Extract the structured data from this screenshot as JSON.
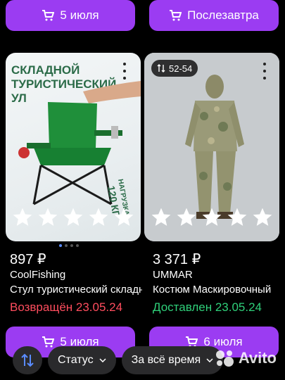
{
  "top_buttons": [
    {
      "label": "5 июля"
    },
    {
      "label": "Послезавтра"
    }
  ],
  "products": [
    {
      "image_caption_top": "СКЛАДНОЙ",
      "image_caption_mid": "ТУРИСТИЧЕСКИЙ",
      "image_caption_bot": "УЛ",
      "image_load_label": "НАГРУЗКА",
      "image_load_value": "120 КГ",
      "price": "897 ₽",
      "brand": "CoolFishing",
      "title": "Стул туристический складной",
      "status": "Возвращён 23.05.24"
    },
    {
      "size_badge": "52-54",
      "price": "3 371 ₽",
      "brand": "UMMAR",
      "title": "Костюм Маскировочный",
      "status": "Доставлен 23.05.24"
    }
  ],
  "bottom_buttons": [
    {
      "label": "5 июля"
    },
    {
      "label": "6 июля"
    }
  ],
  "filters": {
    "status_label": "Статус",
    "period_label": "За всё время"
  },
  "watermark": "Avito",
  "colors": {
    "accent": "#9b3cf2",
    "returned": "#ff4d5e",
    "delivered": "#2fd07a"
  }
}
